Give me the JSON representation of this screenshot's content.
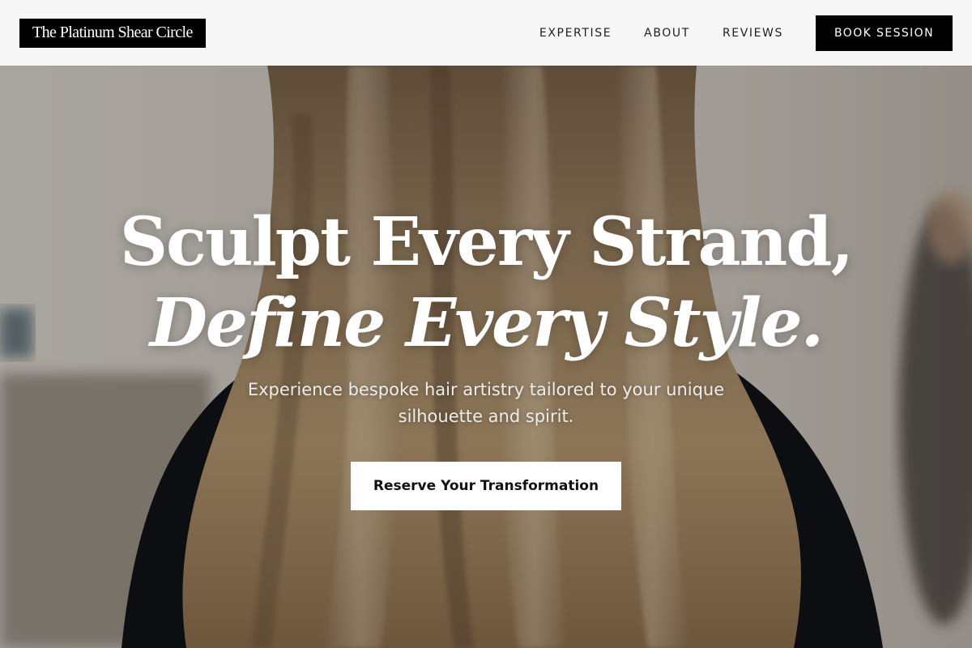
{
  "header": {
    "brand": "The Platinum Shear Circle",
    "nav": [
      {
        "label": "EXPERTISE"
      },
      {
        "label": "ABOUT"
      },
      {
        "label": "REVIEWS"
      }
    ],
    "cta_label": "BOOK SESSION"
  },
  "hero": {
    "headline_line1": "Sculpt Every Strand,",
    "headline_line2": "Define Every Style.",
    "subtitle": "Experience bespoke hair artistry tailored to your unique silhouette and spirit.",
    "cta_label": "Reserve Your Transformation"
  },
  "colors": {
    "header_bg": "#f7f7f7",
    "brand_bg": "#000000",
    "primary_button_bg": "#000000",
    "hero_button_bg": "#ffffff",
    "hero_text": "#ffffff"
  }
}
